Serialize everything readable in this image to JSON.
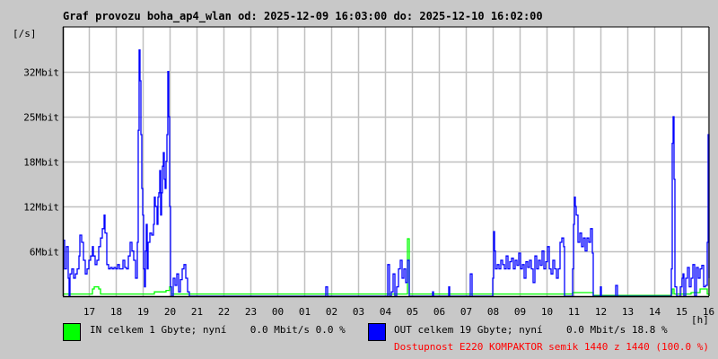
{
  "chart_data": {
    "type": "line",
    "title": "Graf provozu boha_ap4_wlan od: 2025-12-09 16:03:00 do: 2025-12-10 16:02:00",
    "ylabel": "[/s]",
    "xlabel": "[h]",
    "x_unit": "minutes since 2025-12-09 16:03",
    "xlim": [
      0,
      1440
    ],
    "ylim": [
      0,
      37.5
    ],
    "y_unit": "Mbit/s",
    "grid": true,
    "y_ticks": [
      {
        "value": 6.25,
        "label": "6Mbit"
      },
      {
        "value": 12.5,
        "label": "12Mbit"
      },
      {
        "value": 18.75,
        "label": "18Mbit"
      },
      {
        "value": 25,
        "label": "25Mbit"
      },
      {
        "value": 31.25,
        "label": "32Mbit"
      }
    ],
    "x_ticks": [
      {
        "value": 57,
        "label": "17"
      },
      {
        "value": 117,
        "label": "18"
      },
      {
        "value": 177,
        "label": "19"
      },
      {
        "value": 237,
        "label": "20"
      },
      {
        "value": 297,
        "label": "21"
      },
      {
        "value": 357,
        "label": "22"
      },
      {
        "value": 417,
        "label": "23"
      },
      {
        "value": 477,
        "label": "00"
      },
      {
        "value": 537,
        "label": "01"
      },
      {
        "value": 597,
        "label": "02"
      },
      {
        "value": 657,
        "label": "03"
      },
      {
        "value": 717,
        "label": "04"
      },
      {
        "value": 777,
        "label": "05"
      },
      {
        "value": 837,
        "label": "06"
      },
      {
        "value": 897,
        "label": "07"
      },
      {
        "value": 957,
        "label": "08"
      },
      {
        "value": 1017,
        "label": "09"
      },
      {
        "value": 1077,
        "label": "10"
      },
      {
        "value": 1137,
        "label": "11"
      },
      {
        "value": 1197,
        "label": "12"
      },
      {
        "value": 1257,
        "label": "13"
      },
      {
        "value": 1317,
        "label": "14"
      },
      {
        "value": 1377,
        "label": "15"
      },
      {
        "value": 1437,
        "label": "16"
      }
    ],
    "series": [
      {
        "name": "IN",
        "color": "#00ff00",
        "points": [
          [
            0,
            0.3
          ],
          [
            64,
            0.3
          ],
          [
            66,
            1
          ],
          [
            70,
            1.3
          ],
          [
            80,
            1
          ],
          [
            84,
            0.3
          ],
          [
            200,
            0.3
          ],
          [
            204,
            0.6
          ],
          [
            230,
            0.8
          ],
          [
            238,
            1.3
          ],
          [
            242,
            0.3
          ],
          [
            766,
            0.3
          ],
          [
            768,
            8
          ],
          [
            772,
            0.3
          ],
          [
            956,
            0.3
          ],
          [
            1100,
            0.3
          ],
          [
            1136,
            0.5
          ],
          [
            1180,
            0.5
          ],
          [
            1182,
            0.1
          ],
          [
            1356,
            0.3
          ],
          [
            1358,
            1
          ],
          [
            1362,
            0.3
          ],
          [
            1400,
            0.5
          ],
          [
            1420,
            1
          ],
          [
            1436,
            0.3
          ],
          [
            1440,
            0
          ]
        ]
      },
      {
        "name": "OUT",
        "color": "#0000ff",
        "points": [
          [
            0,
            7.8
          ],
          [
            4,
            3.8
          ],
          [
            8,
            6.9
          ],
          [
            12,
            2.5
          ],
          [
            14,
            0
          ],
          [
            16,
            3.1
          ],
          [
            20,
            3.8
          ],
          [
            24,
            2.5
          ],
          [
            28,
            3.1
          ],
          [
            32,
            3.8
          ],
          [
            36,
            5.6
          ],
          [
            38,
            8.5
          ],
          [
            42,
            7.5
          ],
          [
            46,
            5
          ],
          [
            50,
            3.1
          ],
          [
            54,
            3.8
          ],
          [
            58,
            5
          ],
          [
            62,
            5.6
          ],
          [
            66,
            6.9
          ],
          [
            68,
            5.6
          ],
          [
            72,
            4.4
          ],
          [
            76,
            5
          ],
          [
            80,
            6.9
          ],
          [
            84,
            8.1
          ],
          [
            88,
            9.4
          ],
          [
            92,
            11.3
          ],
          [
            94,
            8.8
          ],
          [
            98,
            4.4
          ],
          [
            102,
            3.8
          ],
          [
            106,
            4
          ],
          [
            110,
            3.8
          ],
          [
            114,
            4
          ],
          [
            118,
            3.8
          ],
          [
            122,
            4.4
          ],
          [
            126,
            3.8
          ],
          [
            130,
            3.8
          ],
          [
            134,
            5
          ],
          [
            138,
            4
          ],
          [
            142,
            3.8
          ],
          [
            146,
            5.6
          ],
          [
            150,
            7.5
          ],
          [
            154,
            6.3
          ],
          [
            158,
            5
          ],
          [
            162,
            2.5
          ],
          [
            166,
            7.5
          ],
          [
            168,
            23.1
          ],
          [
            170,
            34.3
          ],
          [
            172,
            30
          ],
          [
            174,
            22.5
          ],
          [
            176,
            15
          ],
          [
            178,
            11.3
          ],
          [
            180,
            3.8
          ],
          [
            182,
            1.3
          ],
          [
            184,
            6.3
          ],
          [
            186,
            10
          ],
          [
            188,
            3.8
          ],
          [
            190,
            7.5
          ],
          [
            194,
            8.8
          ],
          [
            198,
            8.5
          ],
          [
            202,
            10
          ],
          [
            204,
            13.8
          ],
          [
            206,
            12.5
          ],
          [
            210,
            10
          ],
          [
            212,
            13.8
          ],
          [
            214,
            14.4
          ],
          [
            216,
            17.5
          ],
          [
            218,
            11.3
          ],
          [
            220,
            14.4
          ],
          [
            222,
            18.1
          ],
          [
            224,
            20
          ],
          [
            226,
            16.3
          ],
          [
            228,
            15
          ],
          [
            230,
            18.8
          ],
          [
            232,
            22.5
          ],
          [
            234,
            31.3
          ],
          [
            236,
            25
          ],
          [
            238,
            12.5
          ],
          [
            240,
            1.3
          ],
          [
            242,
            0
          ],
          [
            246,
            2.5
          ],
          [
            250,
            1.5
          ],
          [
            254,
            3.1
          ],
          [
            258,
            0.6
          ],
          [
            262,
            2.3
          ],
          [
            266,
            3.8
          ],
          [
            270,
            4.4
          ],
          [
            274,
            2.5
          ],
          [
            278,
            0.6
          ],
          [
            282,
            0
          ],
          [
            582,
            0
          ],
          [
            586,
            1.3
          ],
          [
            590,
            0
          ],
          [
            720,
            0
          ],
          [
            724,
            4.4
          ],
          [
            728,
            0
          ],
          [
            732,
            0.6
          ],
          [
            736,
            3.1
          ],
          [
            740,
            0
          ],
          [
            744,
            1.3
          ],
          [
            748,
            3.8
          ],
          [
            752,
            5
          ],
          [
            756,
            2.5
          ],
          [
            760,
            3.8
          ],
          [
            764,
            1.9
          ],
          [
            768,
            5
          ],
          [
            772,
            0
          ],
          [
            822,
            0
          ],
          [
            824,
            0.6
          ],
          [
            826,
            0
          ],
          [
            858,
            0
          ],
          [
            860,
            1.3
          ],
          [
            862,
            0
          ],
          [
            904,
            0
          ],
          [
            908,
            3.1
          ],
          [
            912,
            0
          ],
          [
            956,
            0
          ],
          [
            958,
            2.5
          ],
          [
            960,
            9
          ],
          [
            962,
            6.3
          ],
          [
            964,
            3.8
          ],
          [
            968,
            4.4
          ],
          [
            972,
            3.8
          ],
          [
            976,
            5
          ],
          [
            980,
            4.4
          ],
          [
            984,
            3.8
          ],
          [
            988,
            5.6
          ],
          [
            992,
            3.8
          ],
          [
            996,
            4.8
          ],
          [
            1000,
            5.3
          ],
          [
            1004,
            3.8
          ],
          [
            1008,
            5
          ],
          [
            1012,
            4.3
          ],
          [
            1016,
            6
          ],
          [
            1020,
            3.8
          ],
          [
            1024,
            4.4
          ],
          [
            1028,
            2.5
          ],
          [
            1032,
            4.8
          ],
          [
            1036,
            4
          ],
          [
            1040,
            5
          ],
          [
            1044,
            3.8
          ],
          [
            1048,
            1.9
          ],
          [
            1052,
            5.6
          ],
          [
            1056,
            3.8
          ],
          [
            1060,
            5
          ],
          [
            1064,
            4.3
          ],
          [
            1068,
            6.3
          ],
          [
            1072,
            3.8
          ],
          [
            1076,
            4.8
          ],
          [
            1080,
            6.9
          ],
          [
            1084,
            3.8
          ],
          [
            1088,
            3.1
          ],
          [
            1092,
            5
          ],
          [
            1096,
            3.8
          ],
          [
            1100,
            2.5
          ],
          [
            1104,
            3.8
          ],
          [
            1108,
            7.5
          ],
          [
            1112,
            8.1
          ],
          [
            1116,
            6.9
          ],
          [
            1118,
            0
          ],
          [
            1134,
            0
          ],
          [
            1136,
            3.8
          ],
          [
            1138,
            10
          ],
          [
            1140,
            13.8
          ],
          [
            1142,
            12.5
          ],
          [
            1144,
            11.3
          ],
          [
            1148,
            7.5
          ],
          [
            1152,
            8.8
          ],
          [
            1156,
            6.9
          ],
          [
            1160,
            8.1
          ],
          [
            1164,
            6.3
          ],
          [
            1168,
            8.1
          ],
          [
            1172,
            7.5
          ],
          [
            1176,
            9.4
          ],
          [
            1180,
            6
          ],
          [
            1182,
            0
          ],
          [
            1196,
            0
          ],
          [
            1198,
            1.3
          ],
          [
            1200,
            0
          ],
          [
            1230,
            0
          ],
          [
            1232,
            1.5
          ],
          [
            1236,
            0
          ],
          [
            1350,
            0
          ],
          [
            1356,
            3.8
          ],
          [
            1358,
            21.3
          ],
          [
            1360,
            25
          ],
          [
            1362,
            16.3
          ],
          [
            1364,
            1.3
          ],
          [
            1368,
            0
          ],
          [
            1376,
            1.3
          ],
          [
            1380,
            2.5
          ],
          [
            1382,
            3.1
          ],
          [
            1384,
            0
          ],
          [
            1388,
            2.5
          ],
          [
            1392,
            4
          ],
          [
            1396,
            1.3
          ],
          [
            1400,
            2.5
          ],
          [
            1404,
            4.4
          ],
          [
            1408,
            0
          ],
          [
            1412,
            4
          ],
          [
            1416,
            2.5
          ],
          [
            1420,
            3.8
          ],
          [
            1424,
            4.3
          ],
          [
            1428,
            1.3
          ],
          [
            1432,
            1.5
          ],
          [
            1436,
            7.5
          ],
          [
            1438,
            22.5
          ],
          [
            1440,
            2.5
          ]
        ]
      }
    ]
  },
  "legend": {
    "in_color": "#00ff00",
    "out_color": "#0000ff",
    "in_text": "IN celkem 1 Gbyte; nyní    0.0 Mbit/s 0.0 %",
    "out_text": "OUT celkem 19 Gbyte; nyní    0.0 Mbit/s 18.8 %",
    "availability": "Dostupnost E220 KOMPAKTOR semik 1440 z 1440 (100.0 %)"
  }
}
